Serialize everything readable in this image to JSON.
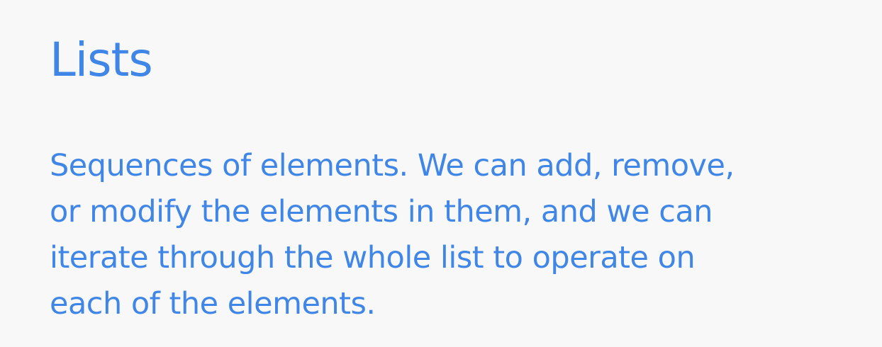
{
  "slide": {
    "title": "Lists",
    "body_lines": [
      "Sequences of elements. We can add, remove,",
      "or modify the elements in them, and we can",
      "iterate through the whole list to operate on",
      "each of the elements."
    ]
  },
  "colors": {
    "text": "#3f86e6",
    "background": "#f8f8f8"
  }
}
